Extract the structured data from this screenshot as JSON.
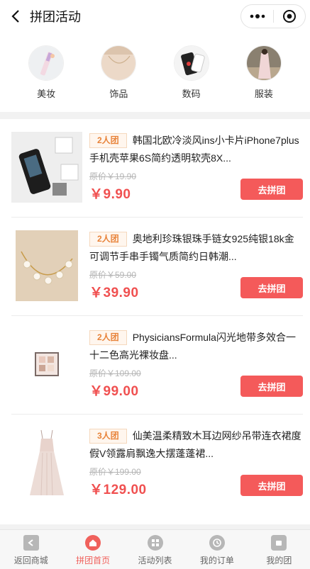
{
  "nav": {
    "title": "拼团活动"
  },
  "categories": [
    {
      "label": "美妆"
    },
    {
      "label": "饰品"
    },
    {
      "label": "数码"
    },
    {
      "label": "服装"
    }
  ],
  "products": [
    {
      "badge": "2人团",
      "title": "韩国北欧冷淡风ins小卡片iPhone7plus手机壳苹果6S简约透明软壳8X...",
      "orig": "原价￥19.90",
      "price": "￥9.90",
      "cta": "去拼团"
    },
    {
      "badge": "2人团",
      "title": "奥地利珍珠银珠手链女925纯银18k金可调节手串手镯气质简约日韩潮...",
      "orig": "原价￥59.00",
      "price": "￥39.90",
      "cta": "去拼团"
    },
    {
      "badge": "2人团",
      "title": "PhysiciansFormula闪光地带多效合一十二色高光裸妆盘...",
      "orig": "原价￥109.00",
      "price": "￥99.00",
      "cta": "去拼团"
    },
    {
      "badge": "3人团",
      "title": "仙美温柔精致木耳边网纱吊带连衣裙度假V领露肩飘逸大摆蓬蓬裙...",
      "orig": "原价￥199.00",
      "price": "￥129.00",
      "cta": "去拼团"
    }
  ],
  "tabs": [
    {
      "label": "返回商城",
      "icon": "back-store-icon"
    },
    {
      "label": "拼团首页",
      "icon": "home-icon",
      "active": true
    },
    {
      "label": "活动列表",
      "icon": "grid-icon"
    },
    {
      "label": "我的订单",
      "icon": "clock-icon"
    },
    {
      "label": "我的团",
      "icon": "group-icon"
    }
  ],
  "colors": {
    "accent": "#f45a5a",
    "badge": "#e8833a",
    "price": "#f05050"
  }
}
